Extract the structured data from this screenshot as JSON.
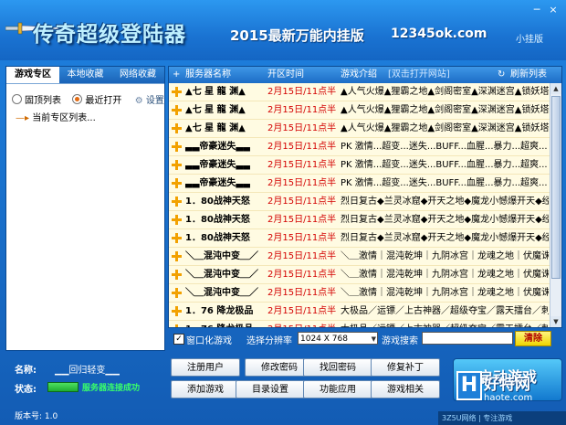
{
  "header": {
    "app_title": "传奇超级登陆器",
    "subtitle": "2015最新万能内挂版",
    "site": "12345ok.com",
    "tray_link": "小挂版"
  },
  "window_buttons": {
    "minimize": "─",
    "close": "×"
  },
  "left_panel": {
    "tabs": [
      {
        "label": "游戏专区",
        "active": true
      },
      {
        "label": "本地收藏",
        "active": false
      },
      {
        "label": "网络收藏",
        "active": false
      }
    ],
    "radio_top": "固顶列表",
    "radio_recent": "最近打开",
    "settings": "设置",
    "tree_item": "当前专区列表..."
  },
  "table": {
    "headers": [
      "服务器名称",
      "开区时间",
      "游戏介绍",
      "[双击打开网站]",
      "刷新列表"
    ],
    "rows": [
      {
        "name": "▲七 星 龍 渊▲",
        "time": "2月15日/11点半",
        "intro": "▲人气火爆▲狸霸之地▲剑阁密室▲深渊迷宫▲锁妖塔"
      },
      {
        "name": "▲七 星 龍 渊▲",
        "time": "2月15日/11点半",
        "intro": "▲人气火爆▲狸霸之地▲剑阁密室▲深渊迷宫▲锁妖塔"
      },
      {
        "name": "▲七 星 龍 渊▲",
        "time": "2月15日/11点半",
        "intro": "▲人气火爆▲狸霸之地▲剑阁密室▲深渊迷宫▲锁妖塔"
      },
      {
        "name": "▃▃帝豪迷失▃▃",
        "time": "2月15日/11点半",
        "intro": "PK 激情...超变...迷失...BUFF...血腥...暴力...超爽..."
      },
      {
        "name": "▃▃帝豪迷失▃▃",
        "time": "2月15日/11点半",
        "intro": "PK 激情...超变...迷失...BUFF...血腥...暴力...超爽..."
      },
      {
        "name": "▃▃帝豪迷失▃▃",
        "time": "2月15日/11点半",
        "intro": "PK 激情...超变...迷失...BUFF...血腥...暴力...超爽..."
      },
      {
        "name": "1．80战神天怒",
        "time": "2月15日/11点半",
        "intro": "烈日复古◆兰灵冰窟◆开天之地◆魔龙小憾爆开天◆经典"
      },
      {
        "name": "1．80战神天怒",
        "time": "2月15日/11点半",
        "intro": "烈日复古◆兰灵冰窟◆开天之地◆魔龙小憾爆开天◆经典"
      },
      {
        "name": "1．80战神天怒",
        "time": "2月15日/11点半",
        "intro": "烈日复古◆兰灵冰窟◆开天之地◆魔龙小憾爆开天◆经典"
      },
      {
        "name": "＼＿混沌中变＿／",
        "time": "2月15日/11点半",
        "intro": "＼＿激情｜混沌乾坤｜九阴冰宫｜龙魂之地｜伏魔诛仙"
      },
      {
        "name": "＼＿混沌中变＿／",
        "time": "2月15日/11点半",
        "intro": "＼＿激情｜混沌乾坤｜九阴冰宫｜龙魂之地｜伏魔诛仙"
      },
      {
        "name": "＼＿混沌中变＿／",
        "time": "2月15日/11点半",
        "intro": "＼＿激情｜混沌乾坤｜九阴冰宫｜龙魂之地｜伏魔诛仙"
      },
      {
        "name": "1．76 降龙极品",
        "time": "2月15日/11点半",
        "intro": "大极品／运镖／上古神器／超级夺宝／露天擂台／刺杀"
      },
      {
        "name": "1．76 降龙极品",
        "time": "2月15日/11点半",
        "intro": "大极品／运镖／上古神器／超级夺宝／露天擂台／刺杀"
      },
      {
        "name": "1．76 降龙极品",
        "time": "2月15日/11点半",
        "intro": "大极品／运镖／上古神器／超级夺宝／露天擂台／刺杀"
      }
    ]
  },
  "filter": {
    "windowed_label": "窗口化游戏",
    "resolution_label": "选择分辨率",
    "resolution_value": "1024 X 768",
    "search_label": "游戏搜索",
    "clear_label": "清除"
  },
  "bottom": {
    "name_label": "名称:",
    "name_value": "▁▁回归轻变▁▁",
    "status_label": "状态:",
    "status_text": "服务器连接成功",
    "version": "版本号: 1.0",
    "buttons": [
      "注册用户",
      "修改密码",
      "找回密码",
      "修复补丁",
      "添加游戏",
      "目录设置",
      "功能应用",
      "游戏相关"
    ],
    "launch_label": "启动游戏"
  },
  "watermark": {
    "letter": "H",
    "text": "好特网",
    "url": "haote.com",
    "footer": "3Z5U网络 | 专注游戏"
  },
  "colors": {
    "accent": "#1a73d2",
    "row_bg": "#fffbe2",
    "time_red": "#d40000",
    "status_green": "#39ff6a"
  }
}
